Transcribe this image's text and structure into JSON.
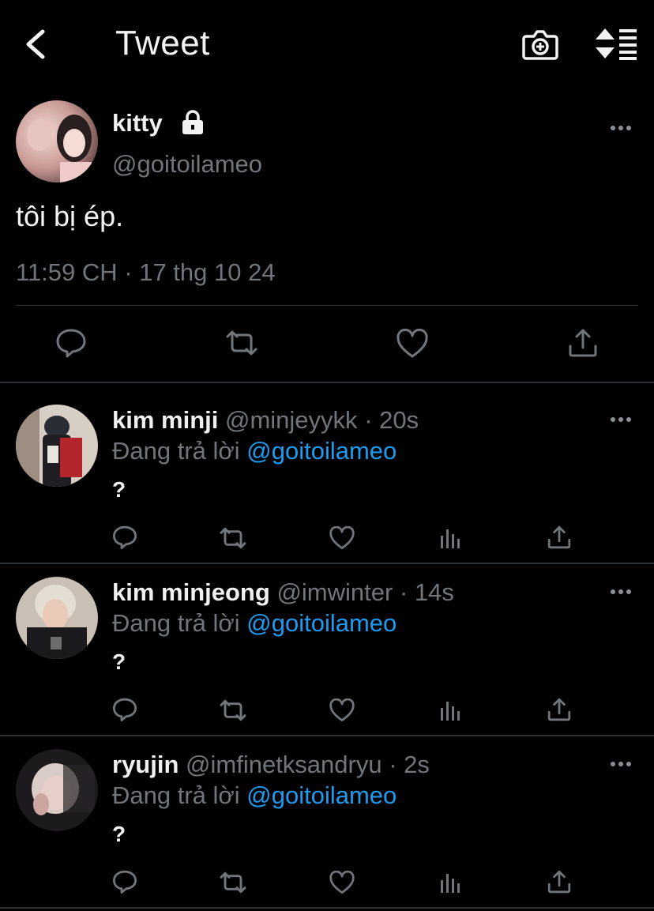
{
  "header": {
    "title": "Tweet",
    "icons": [
      "back-chevron-icon",
      "camera-plus-icon",
      "sort-replies-icon"
    ]
  },
  "main_tweet": {
    "name": "kitty",
    "handle": "@goitoilameo",
    "text": "tôi bị ép.",
    "time": "11:59 CH · 17 thg 10 24",
    "protected": true
  },
  "replies": [
    {
      "name": "kim minji",
      "handle": "@minjeyykk",
      "time": "· 20s",
      "replying_label": "Đang trả lời",
      "mention": "@goitoilameo",
      "text": "?"
    },
    {
      "name": "kim minjeong",
      "handle": "@imwinter",
      "time": "· 14s",
      "replying_label": "Đang trả lời",
      "mention": "@goitoilameo",
      "text": "?"
    },
    {
      "name": "ryujin",
      "handle": "@imfinetksandryu",
      "time": "· 2s",
      "replying_label": "Đang trả lời",
      "mention": "@goitoilameo",
      "text": "?"
    }
  ],
  "colors": {
    "background": "#000000",
    "text": "#e7e9ea",
    "muted": "#71767b",
    "link": "#1d9bf0",
    "divider": "#2f3336"
  }
}
